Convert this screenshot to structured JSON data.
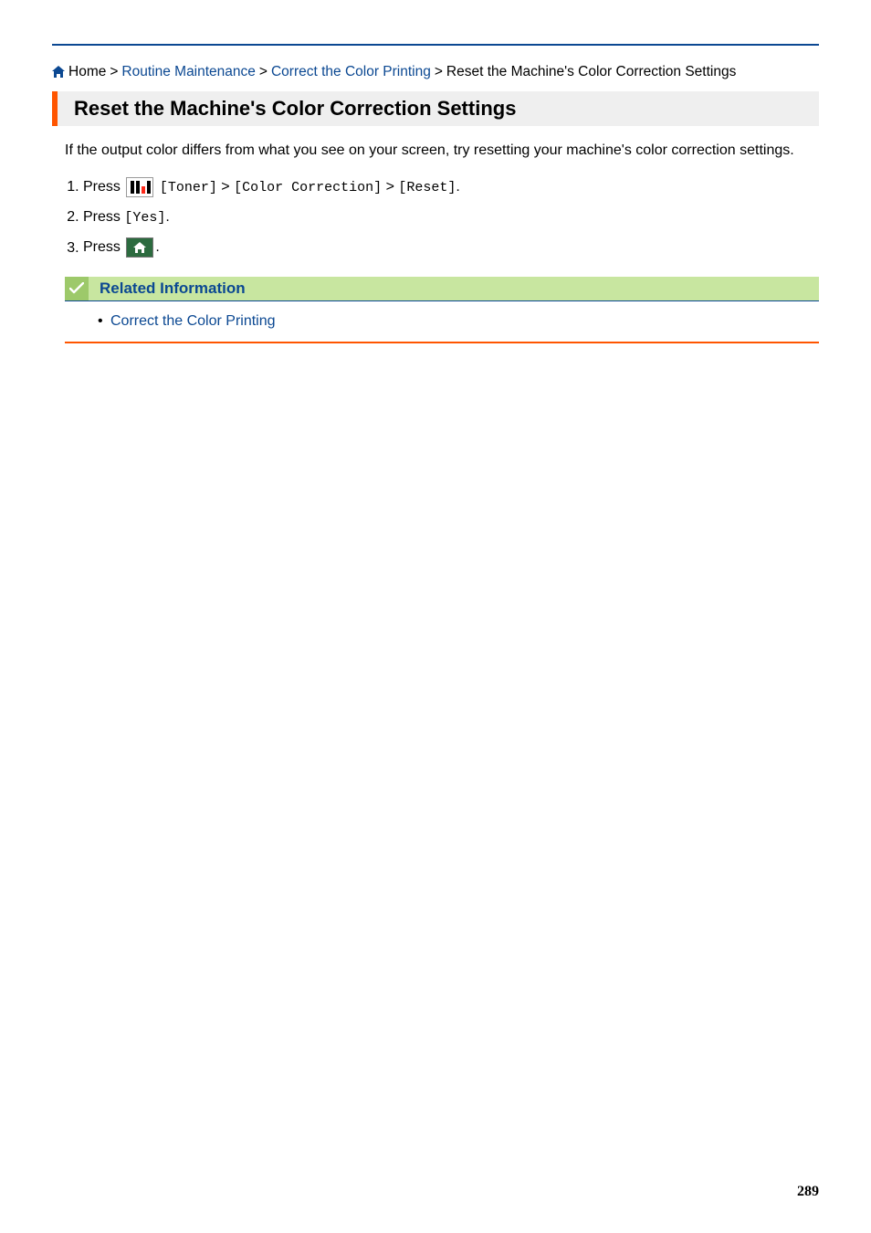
{
  "breadcrumb": {
    "home": "Home",
    "sep": ">",
    "items": [
      {
        "label": "Routine Maintenance",
        "link": true
      },
      {
        "label": "Correct the Color Printing",
        "link": true
      },
      {
        "label": "Reset the Machine's Color Correction Settings",
        "link": false
      }
    ]
  },
  "title": "Reset the Machine's Color Correction Settings",
  "intro": "If the output color differs from what you see on your screen, try resetting your machine's color correction settings.",
  "steps": {
    "s1_press": "Press",
    "s1_toner": "[Toner]",
    "s1_gt1": ">",
    "s1_color": "[Color Correction]",
    "s1_gt2": ">",
    "s1_reset": "[Reset]",
    "s1_period": ".",
    "s2_press": "Press",
    "s2_yes": "[Yes]",
    "s2_period": ".",
    "s3_press": "Press",
    "s3_period": "."
  },
  "related": {
    "heading": "Related Information",
    "items": [
      {
        "label": "Correct the Color Printing"
      }
    ]
  },
  "pageNumber": "289",
  "icons": {
    "home": "home-icon",
    "toner": "toner-icon",
    "homeButton": "home-button-icon",
    "check": "check-icon"
  }
}
